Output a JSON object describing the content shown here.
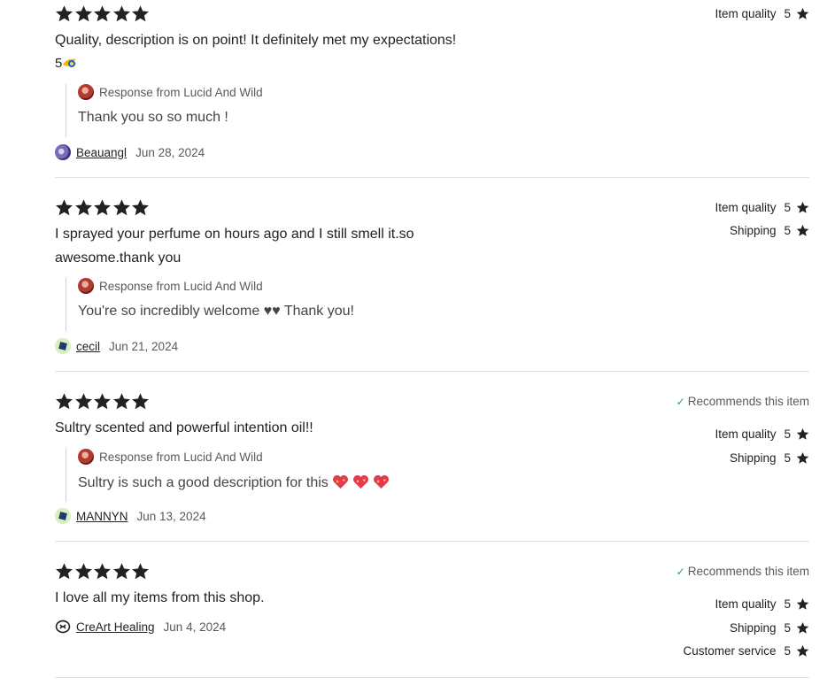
{
  "reviews": [
    {
      "text": "Quality, description is on point! It definitely met my expectations!",
      "extra_line": "5",
      "response_label": "Response from Lucid And Wild",
      "response_text": "Thank you so so much !",
      "user": "Beauangl",
      "date": "Jun 28, 2024",
      "ratings": [
        {
          "label": "Item quality",
          "value": "5"
        }
      ]
    },
    {
      "text_line1": "I sprayed your perfume on hours ago and I still smell it.so",
      "text_line2": "awesome.thank you",
      "response_label": "Response from Lucid And Wild",
      "response_text": "You're so incredibly welcome ♥♥ Thank you!",
      "user": "cecil",
      "date": "Jun 21, 2024",
      "ratings": [
        {
          "label": "Item quality",
          "value": "5"
        },
        {
          "label": "Shipping",
          "value": "5"
        }
      ]
    },
    {
      "text": "Sultry scented and powerful intention oil!!",
      "recommends": "Recommends this item",
      "response_label": "Response from Lucid And Wild",
      "response_text": "Sultry is such a good description for this",
      "user": "MANNYN",
      "date": "Jun 13, 2024",
      "ratings": [
        {
          "label": "Item quality",
          "value": "5"
        },
        {
          "label": "Shipping",
          "value": "5"
        }
      ]
    },
    {
      "text": "I love all my items from this shop.",
      "recommends": "Recommends this item",
      "user": "CreArt Healing",
      "date": "Jun 4, 2024",
      "ratings": [
        {
          "label": "Item quality",
          "value": "5"
        },
        {
          "label": "Shipping",
          "value": "5"
        },
        {
          "label": "Customer service",
          "value": "5"
        }
      ]
    }
  ],
  "star_rating": 5,
  "colors": {
    "star": "#222222",
    "check": "#2e9e4f",
    "divider": "#e1e1e1"
  },
  "icons": {
    "star": "star-icon",
    "check": "checkmark-icon",
    "heart": "sparkling-heart-icon"
  }
}
